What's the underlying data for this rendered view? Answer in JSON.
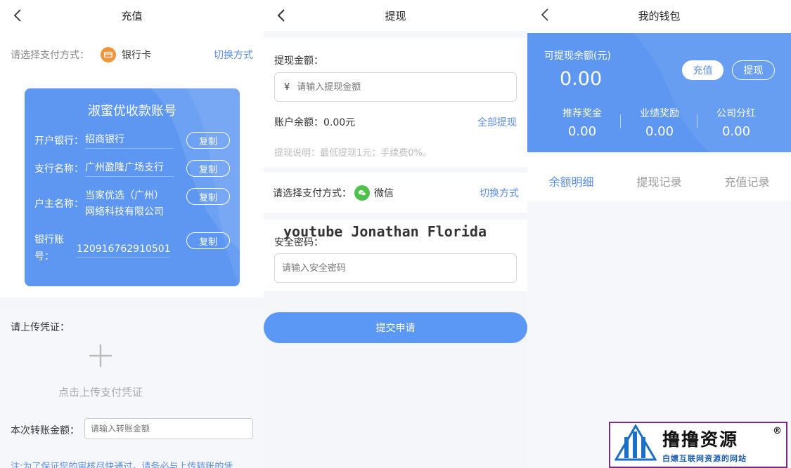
{
  "recharge": {
    "title": "充值",
    "pay_label": "请选择支付方式：",
    "pay_method": "银行卡",
    "switch_label": "切换方式",
    "card": {
      "title": "淑蜜优收款账号",
      "rows": [
        {
          "label": "开户银行：",
          "value": "招商银行"
        },
        {
          "label": "支行名称：",
          "value": "广州盈隆广场支行"
        },
        {
          "label": "户主名称：",
          "value_line1": "当家优选（广州）",
          "value_line2": "网络科技有限公司"
        },
        {
          "label_line1": "银行账",
          "label_line2": "号：",
          "value": "120916762910501"
        }
      ],
      "copy_label": "复制"
    },
    "upload_label": "请上传凭证：",
    "upload_hint": "点击上传支付凭证",
    "amount_label": "本次转账金额：",
    "amount_placeholder": "请输入转账金额",
    "note": "注:为了保证您的审核尽快通过，请务必与上传转账的凭"
  },
  "withdraw": {
    "title": "提现",
    "amount_label": "提现金额：",
    "currency_symbol": "¥",
    "amount_placeholder": "请输入提现金额",
    "balance_text": "账户余额：0.00元",
    "all_label": "全部提现",
    "rule_text": "提现说明：最低提现1元；手续费0%。",
    "pay_label": "请选择支付方式：",
    "pay_method": "微信",
    "switch_label": "切换方式",
    "password_label": "安全密码：",
    "password_placeholder": "请输入安全密码",
    "submit_label": "提交申请"
  },
  "watermark": "youtube Jonathan Florida",
  "wallet": {
    "title": "我的钱包",
    "available_label": "可提现余额(元)",
    "available_amount": "0.00",
    "recharge_label": "充值",
    "withdraw_label": "提现",
    "stats": [
      {
        "name": "推荐奖金",
        "value": "0.00"
      },
      {
        "name": "业绩奖励",
        "value": "0.00"
      },
      {
        "name": "公司分红",
        "value": "0.00"
      }
    ],
    "tabs": [
      "余额明细",
      "提现记录",
      "充值记录"
    ],
    "active_tab": 0
  },
  "logo": {
    "main": "撸撸资源",
    "sub": "白嫖互联网资源的网站",
    "reg": "®"
  },
  "colors": {
    "primary": "#5d97f2",
    "link": "#5b8de6",
    "bank_orange": "#f0953a",
    "wechat_green": "#4cc24b"
  }
}
